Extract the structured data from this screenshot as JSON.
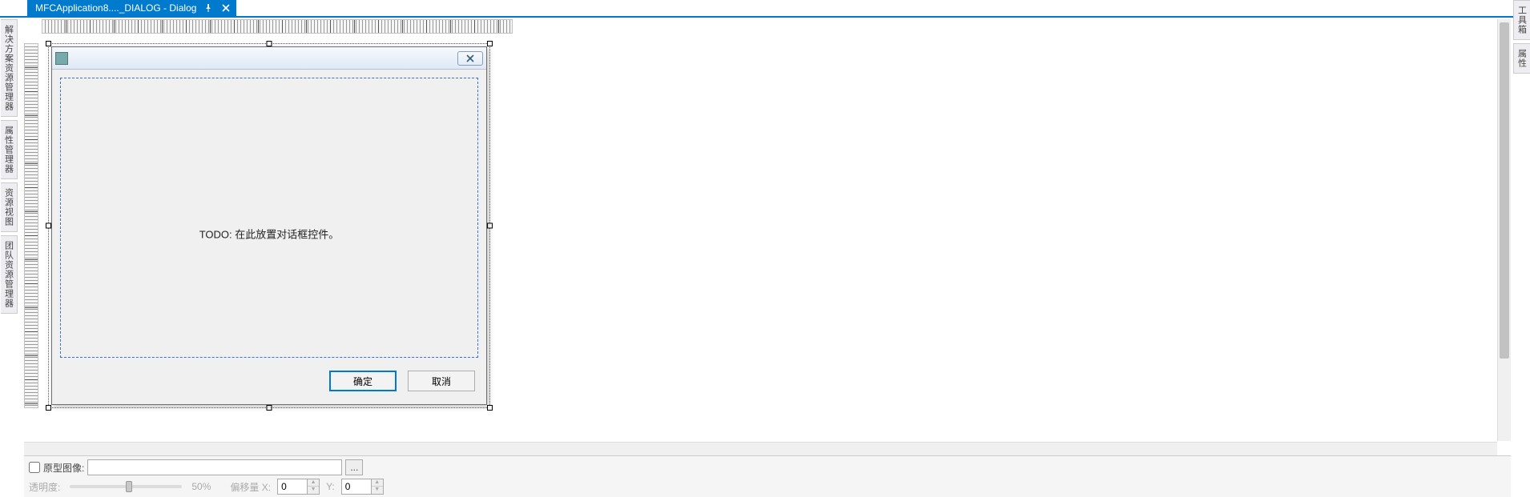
{
  "tab": {
    "title": "MFCApplication8...._DIALOG - Dialog"
  },
  "left_panels": {
    "solution_explorer": "解决方案资源管理器",
    "property_manager": "属性管理器",
    "resource_view": "资源视图",
    "team_explorer": "团队资源管理器"
  },
  "right_panels": {
    "toolbox": "工具箱",
    "properties": "属性"
  },
  "dialog": {
    "todo_text": "TODO: 在此放置对话框控件。",
    "ok_label": "确定",
    "cancel_label": "取消"
  },
  "proto": {
    "label": "原型图像:",
    "browse_label": "...",
    "opacity_label": "透明度:",
    "opacity_pct": "50%",
    "offset_x_label": "偏移量 X:",
    "offset_x_value": "0",
    "offset_y_label": "Y:",
    "offset_y_value": "0"
  }
}
